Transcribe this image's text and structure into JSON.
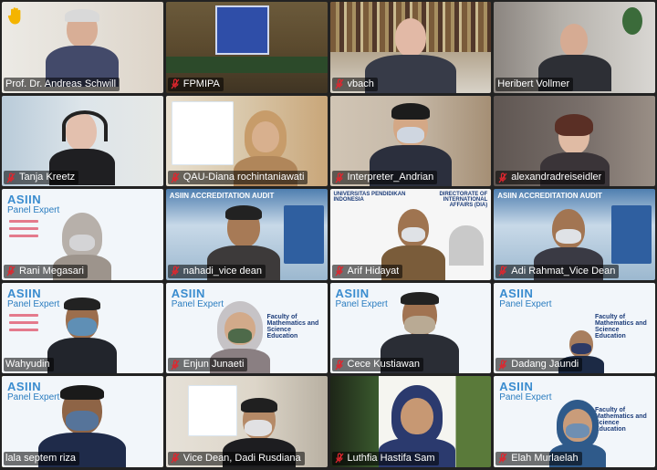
{
  "participants": [
    {
      "name": "Prof. Dr. Andreas Schwill",
      "bg": "#e9e5df",
      "muted": false,
      "hand": true
    },
    {
      "name": "FPMIPA",
      "bg": "#5b4a2e",
      "muted": true,
      "hand": false
    },
    {
      "name": "vbach",
      "bg": "#8a7b63",
      "muted": true,
      "hand": false
    },
    {
      "name": "Heribert Vollmer",
      "bg": "#b8b3ac",
      "muted": false,
      "hand": false
    },
    {
      "name": "Tanja Kreetz",
      "bg": "#d7dde2",
      "muted": true,
      "hand": false
    },
    {
      "name": "QAU-Diana rochintaniawati",
      "bg": "#d9c7a9",
      "muted": true,
      "hand": false
    },
    {
      "name": "Interpreter_Andrian",
      "bg": "#c6b9a8",
      "muted": true,
      "hand": false
    },
    {
      "name": "alexandradreiseidler",
      "bg": "#6f6764",
      "muted": true,
      "hand": false
    },
    {
      "name": "Rani Megasari",
      "bg": "#f2f6fa",
      "muted": true,
      "hand": false
    },
    {
      "name": "nahadi_vice dean",
      "bg": "#c8d9e8",
      "muted": true,
      "hand": false
    },
    {
      "name": "Arif Hidayat",
      "bg": "#f6f6f6",
      "muted": true,
      "hand": false
    },
    {
      "name": "Adi Rahmat_Vice Dean",
      "bg": "#c8d9e8",
      "muted": true,
      "hand": false
    },
    {
      "name": "Wahyudin",
      "bg": "#f2f6fa",
      "muted": false,
      "hand": false
    },
    {
      "name": "Enjun Junaeti",
      "bg": "#f2f6fa",
      "muted": true,
      "hand": false
    },
    {
      "name": "Cece Kustiawan",
      "bg": "#f2f6fa",
      "muted": true,
      "hand": false
    },
    {
      "name": "Dadang Jaundi",
      "bg": "#f2f6fa",
      "muted": true,
      "hand": false
    },
    {
      "name": "lala septem riza",
      "bg": "#f2f6fa",
      "muted": false,
      "hand": false
    },
    {
      "name": "Vice Dean, Dadi Rusdiana",
      "bg": "#ddd6c9",
      "muted": true,
      "hand": false
    },
    {
      "name": "Luthfia Hastifa Sam",
      "bg": "#4a6b3a",
      "muted": true,
      "hand": false
    },
    {
      "name": "Elah Murlaelah",
      "bg": "#f2f6fa",
      "muted": true,
      "hand": false
    }
  ],
  "slide_text": {
    "asiin": "ASIIN",
    "panel": "Panel Expert",
    "faculty": "Faculty of Mathematics and Science Education",
    "accreditation": "ASIIN ACCREDITATION AUDIT",
    "directorate": "DIRECTORATE OF INTERNATIONAL AFFAIRS (DIA)",
    "upi": "UNIVERSITAS PENDIDIKAN INDONESIA"
  },
  "colors": {
    "speaking_outline": "#f5d800",
    "mute_red": "#e0262e",
    "hand_yellow": "#f4b400"
  }
}
